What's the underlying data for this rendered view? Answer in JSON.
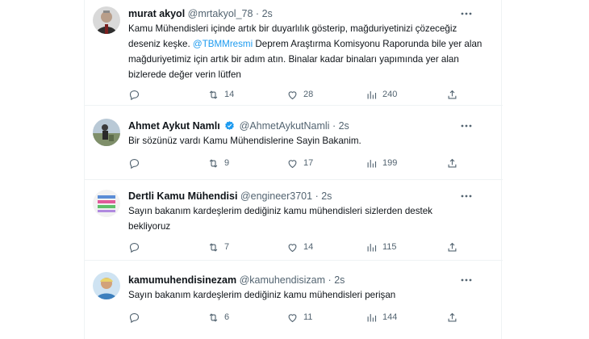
{
  "tweets": [
    {
      "name": "murat akyol",
      "handle": "@mrtakyol_78",
      "dot": "·",
      "time": "2s",
      "text_before": "Kamu Mühendisleri içinde artık bir duyarlılık gösterip, mağduriyetinizi çözeceğiz deseniz keşke. ",
      "mention": "@TBMMresmi",
      "text_after": " Deprem Araştırma Komisyonu Raporunda bile yer alan mağduriyetimiz için artık bir adım atın. Binalar kadar binaları yapımında yer alan bizlerede değer verin lütfen",
      "retweets": "14",
      "likes": "28",
      "views": "240",
      "verified": false
    },
    {
      "name": "Ahmet Aykut Namlı",
      "handle": "@AhmetAykutNamli",
      "dot": "·",
      "time": "2s",
      "text_before": "Bir sözünüz vardı Kamu Mühendislerine Sayin Bakanim.",
      "mention": "",
      "text_after": "",
      "retweets": "9",
      "likes": "17",
      "views": "199",
      "verified": true
    },
    {
      "name": "Dertli Kamu Mühendisi",
      "handle": "@engineer3701",
      "dot": "·",
      "time": "2s",
      "text_before": "Sayın bakanım kardeşlerim dediğiniz kamu mühendisleri sizlerden destek bekliyoruz",
      "mention": "",
      "text_after": "",
      "retweets": "7",
      "likes": "14",
      "views": "115",
      "verified": false
    },
    {
      "name": "kamumuhendisinezam",
      "handle": "@kamuhendisizam",
      "dot": "·",
      "time": "2s",
      "text_before": "Sayın bakanım kardeşlerim dediğiniz kamu mühendisleri perişan",
      "mention": "",
      "text_after": "",
      "retweets": "6",
      "likes": "11",
      "views": "144",
      "verified": false
    }
  ],
  "icons": {
    "reply": "reply-icon",
    "retweet": "retweet-icon",
    "like": "heart-icon",
    "views": "views-icon",
    "share": "share-icon",
    "more": "more-icon",
    "verified": "verified-badge-icon"
  },
  "colors": {
    "text": "#0f1419",
    "muted": "#536471",
    "link": "#1d9bf0",
    "verified": "#1d9bf0",
    "divider": "#eff3f4"
  }
}
